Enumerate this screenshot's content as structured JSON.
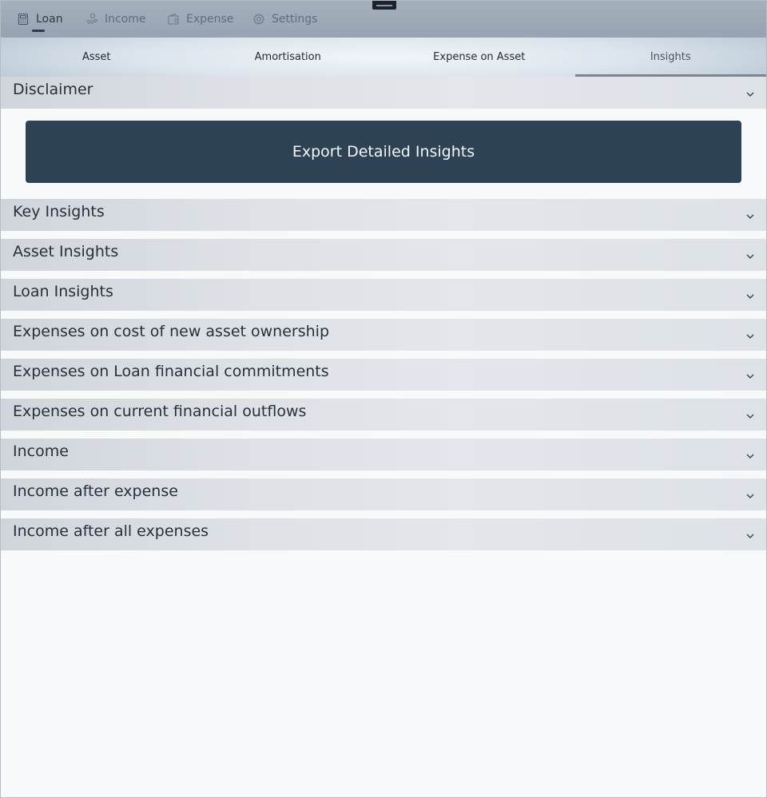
{
  "topnav": {
    "items": [
      {
        "label": "Loan",
        "icon": "calculator-icon",
        "active": true
      },
      {
        "label": "Income",
        "icon": "money-hand-icon",
        "active": false
      },
      {
        "label": "Expense",
        "icon": "wallet-icon",
        "active": false
      },
      {
        "label": "Settings",
        "icon": "gear-icon",
        "active": false
      }
    ]
  },
  "subtabs": {
    "items": [
      {
        "label": "Asset",
        "active": false
      },
      {
        "label": "Amortisation",
        "active": false
      },
      {
        "label": "Expense on Asset",
        "active": false
      },
      {
        "label": "Insights",
        "active": true
      }
    ]
  },
  "accordion": {
    "disclaimer": "Disclaimer",
    "export_button": "Export Detailed Insights",
    "sections": [
      "Key Insights",
      "Asset Insights",
      "Loan Insights",
      "Expenses on cost of new asset ownership",
      "Expenses on Loan financial commitments",
      "Expenses on current financial outflows",
      "Income",
      "Income after expense",
      "Income after all expenses"
    ]
  },
  "colors": {
    "accent": "#2e4255",
    "nav_background": "#9ba6b4",
    "section_background": "#dde1e6"
  }
}
